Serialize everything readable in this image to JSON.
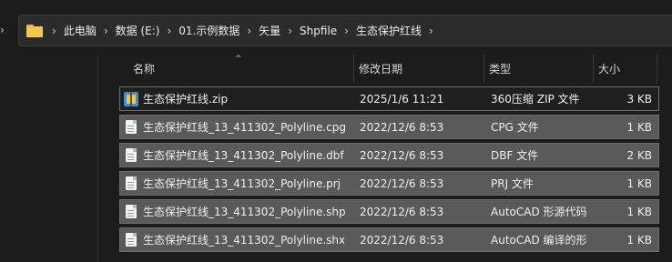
{
  "breadcrumb": [
    "此电脑",
    "数据 (E:)",
    "01.示例数据",
    "矢量",
    "Shpfile",
    "生态保护红线"
  ],
  "separator": "›",
  "side_chevron": "›",
  "columns": {
    "name": "名称",
    "date": "修改日期",
    "type": "类型",
    "size": "大小",
    "sort_indicator": "^"
  },
  "files": [
    {
      "name": "生态保护红线.zip",
      "date": "2025/1/6 11:21",
      "type": "360压缩 ZIP 文件",
      "size": "3 KB",
      "icon": "zip-archive-icon"
    },
    {
      "name": "生态保护红线_13_411302_Polyline.cpg",
      "date": "2022/12/6 8:53",
      "type": "CPG 文件",
      "size": "1 KB",
      "icon": "file-icon"
    },
    {
      "name": "生态保护红线_13_411302_Polyline.dbf",
      "date": "2022/12/6 8:53",
      "type": "DBF 文件",
      "size": "2 KB",
      "icon": "file-icon"
    },
    {
      "name": "生态保护红线_13_411302_Polyline.prj",
      "date": "2022/12/6 8:53",
      "type": "PRJ 文件",
      "size": "1 KB",
      "icon": "file-icon"
    },
    {
      "name": "生态保护红线_13_411302_Polyline.shp",
      "date": "2022/12/6 8:53",
      "type": "AutoCAD 形源代码",
      "size": "1 KB",
      "icon": "file-icon"
    },
    {
      "name": "生态保护红线_13_411302_Polyline.shx",
      "date": "2022/12/6 8:53",
      "type": "AutoCAD 编译的形",
      "size": "1 KB",
      "icon": "file-icon"
    }
  ],
  "colors": {
    "background": "#1c1c1c",
    "selected_row": "#5a5a5a",
    "folder": "#f5c84a"
  }
}
